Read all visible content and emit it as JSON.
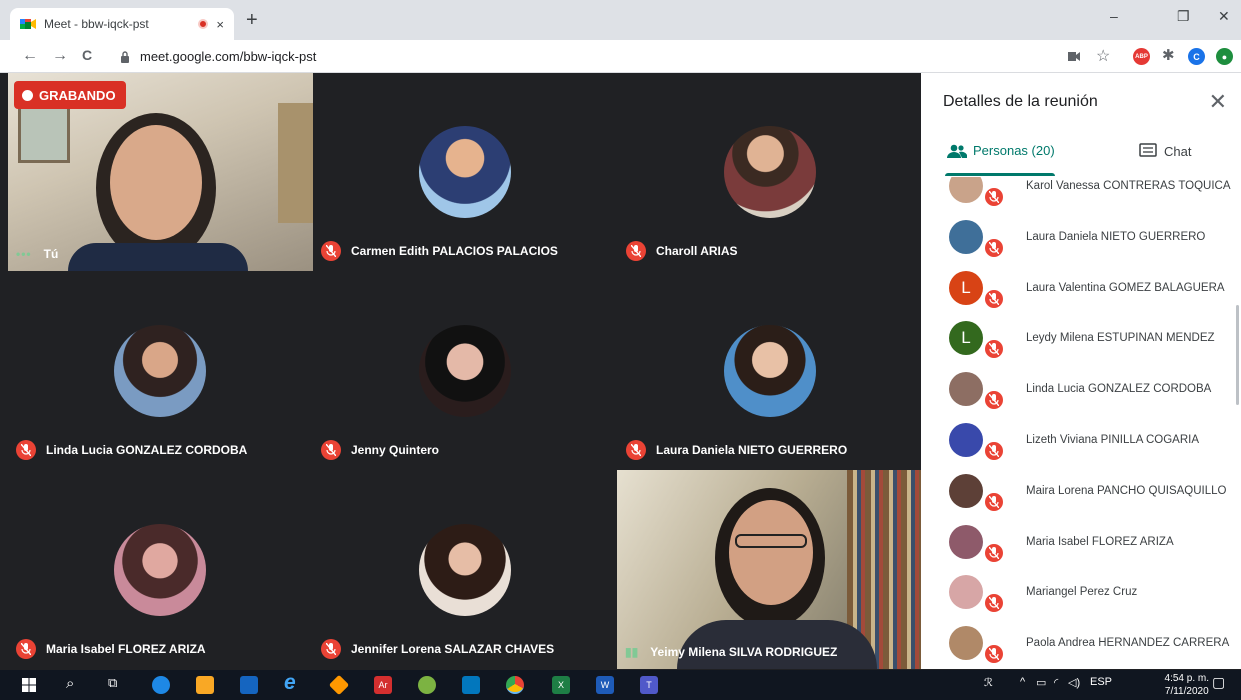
{
  "browser": {
    "tab_title": "Meet - bbw-iqck-pst",
    "tab_close": "×",
    "new_tab": "+",
    "url": "meet.google.com/bbw-iqck-pst",
    "win_minimize": "–",
    "win_restore": "❐",
    "win_close": "✕",
    "back": "←",
    "forward": "→",
    "reload": "C",
    "ext_abp": "ABP",
    "ext_profile": "C"
  },
  "recording_label": "GRABANDO",
  "tiles": [
    {
      "name": "Tú"
    },
    {
      "name": "Carmen Edith PALACIOS PALACIOS"
    },
    {
      "name": "Charoll ARIAS"
    },
    {
      "name": "Linda Lucia GONZALEZ CORDOBA"
    },
    {
      "name": "Jenny Quintero"
    },
    {
      "name": "Laura Daniela NIETO GUERRERO"
    },
    {
      "name": "Maria Isabel FLOREZ ARIZA"
    },
    {
      "name": "Jennifer Lorena SALAZAR CHAVES"
    },
    {
      "name": "Yeimy Milena SILVA RODRIGUEZ"
    }
  ],
  "panel": {
    "title": "Detalles de la reunión",
    "close": "✕",
    "tab_people": "Personas (20)",
    "tab_chat": "Chat",
    "people": [
      {
        "name": "Karol Vanessa CONTRERAS TOQUICA",
        "initial": "",
        "color": "#c9a38a"
      },
      {
        "name": "Laura Daniela NIETO GUERRERO",
        "initial": "",
        "color": "#3f6f99"
      },
      {
        "name": "Laura Valentina GOMEZ BALAGUERA",
        "initial": "L",
        "color": "#d84315"
      },
      {
        "name": "Leydy Milena ESTUPINAN MENDEZ",
        "initial": "L",
        "color": "#33691e"
      },
      {
        "name": "Linda Lucia GONZALEZ CORDOBA",
        "initial": "",
        "color": "#8d6e63"
      },
      {
        "name": "Lizeth Viviana PINILLA COGARIA",
        "initial": "",
        "color": "#3949ab"
      },
      {
        "name": "Maira Lorena PANCHO QUISAQUILLO",
        "initial": "",
        "color": "#5d4037"
      },
      {
        "name": "Maria Isabel FLOREZ ARIZA",
        "initial": "",
        "color": "#8e5a6a"
      },
      {
        "name": "Mariangel Perez Cruz",
        "initial": "",
        "color": "#d7a6a6"
      },
      {
        "name": "Paola Andrea HERNANDEZ CARRERA",
        "initial": "",
        "color": "#b08968"
      }
    ]
  },
  "taskbar": {
    "lang": "ESP",
    "time": "4:54 p. m.",
    "date": "7/11/2020"
  }
}
